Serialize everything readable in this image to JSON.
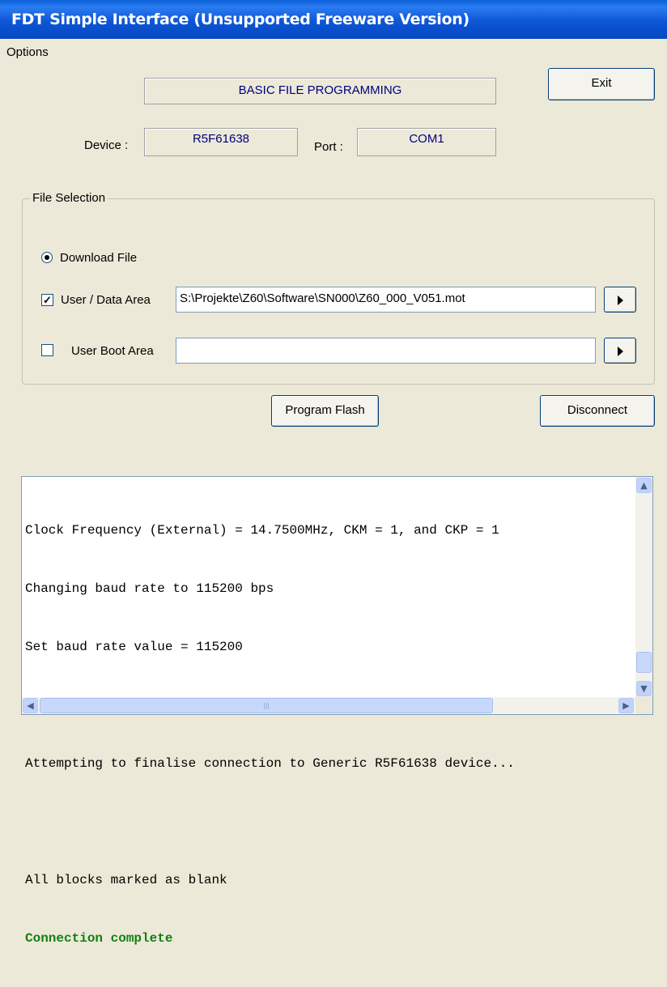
{
  "window": {
    "title": "FDT Simple Interface   (Unsupported Freeware Version)"
  },
  "menu": {
    "options_label": "Options"
  },
  "header": {
    "mode_label": "BASIC FILE PROGRAMMING",
    "exit_label": "Exit"
  },
  "device": {
    "device_label": "Device :",
    "device_value": "R5F61638",
    "port_label": "Port :",
    "port_value": "COM1"
  },
  "file_selection": {
    "group_title": "File Selection",
    "download_file_label": "Download File",
    "download_file_selected": true,
    "user_data_area_label": "User / Data Area",
    "user_data_area_checked": true,
    "user_data_area_path": "S:\\Projekte\\Z60\\Software\\SN000\\Z60_000_V051.mot",
    "user_boot_area_label": "User Boot Area",
    "user_boot_area_checked": false,
    "user_boot_area_path": ""
  },
  "actions": {
    "program_flash_label": "Program Flash",
    "disconnect_label": "Disconnect"
  },
  "log": {
    "lines": [
      "Clock Frequency (External) = 14.7500MHz, CKM = 1, and CKP = 1",
      "Changing baud rate to 115200 bps",
      "Set baud rate value = 115200",
      "",
      "Attempting to finalise connection to Generic R5F61638 device...",
      "",
      "All blocks marked as blank",
      "Connection complete"
    ],
    "status_color": "#138013"
  },
  "scrollbars": {
    "hscroll_grip": "|||"
  }
}
